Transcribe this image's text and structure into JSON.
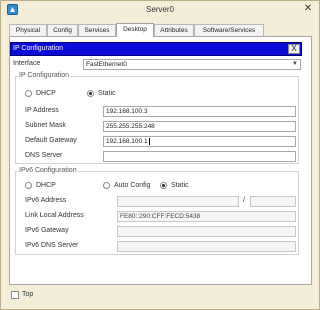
{
  "window": {
    "title": "Server0",
    "close_glyph": "✕",
    "app_icon": "packet-tracer-icon"
  },
  "tabs": [
    {
      "label": "Physical"
    },
    {
      "label": "Config"
    },
    {
      "label": "Services"
    },
    {
      "label": "Desktop",
      "active": true
    },
    {
      "label": "Attributes"
    },
    {
      "label": "Software/Services"
    }
  ],
  "ip_configuration": {
    "title": "IP Configuration",
    "close_label": "X",
    "interface": {
      "label": "Interface",
      "value": "FastEthernet0"
    },
    "ipv4": {
      "group_title": "IP Configuration",
      "dhcp_label": "DHCP",
      "static_label": "Static",
      "mode": "Static",
      "ip_address": {
        "label": "IP Address",
        "value": "192.168.100.3"
      },
      "subnet_mask": {
        "label": "Subnet Mask",
        "value": "255.255.255.248"
      },
      "default_gateway": {
        "label": "Default Gateway",
        "value": "192.168.100.1"
      },
      "dns_server": {
        "label": "DNS Server",
        "value": ""
      }
    },
    "ipv6": {
      "group_title": "IPv6 Configuration",
      "dhcp_label": "DHCP",
      "auto_config_label": "Auto Config",
      "static_label": "Static",
      "mode": "Static",
      "ipv6_address": {
        "label": "IPv6 Address",
        "value": "",
        "prefix": "",
        "separator": "/"
      },
      "link_local": {
        "label": "Link Local Address",
        "value": "FE80::290:CFF:FECD:5438"
      },
      "ipv6_gateway": {
        "label": "IPv6 Gateway",
        "value": ""
      },
      "ipv6_dns": {
        "label": "IPv6 DNS Server",
        "value": ""
      }
    }
  },
  "footer": {
    "top_label": "Top",
    "top_checked": false
  }
}
